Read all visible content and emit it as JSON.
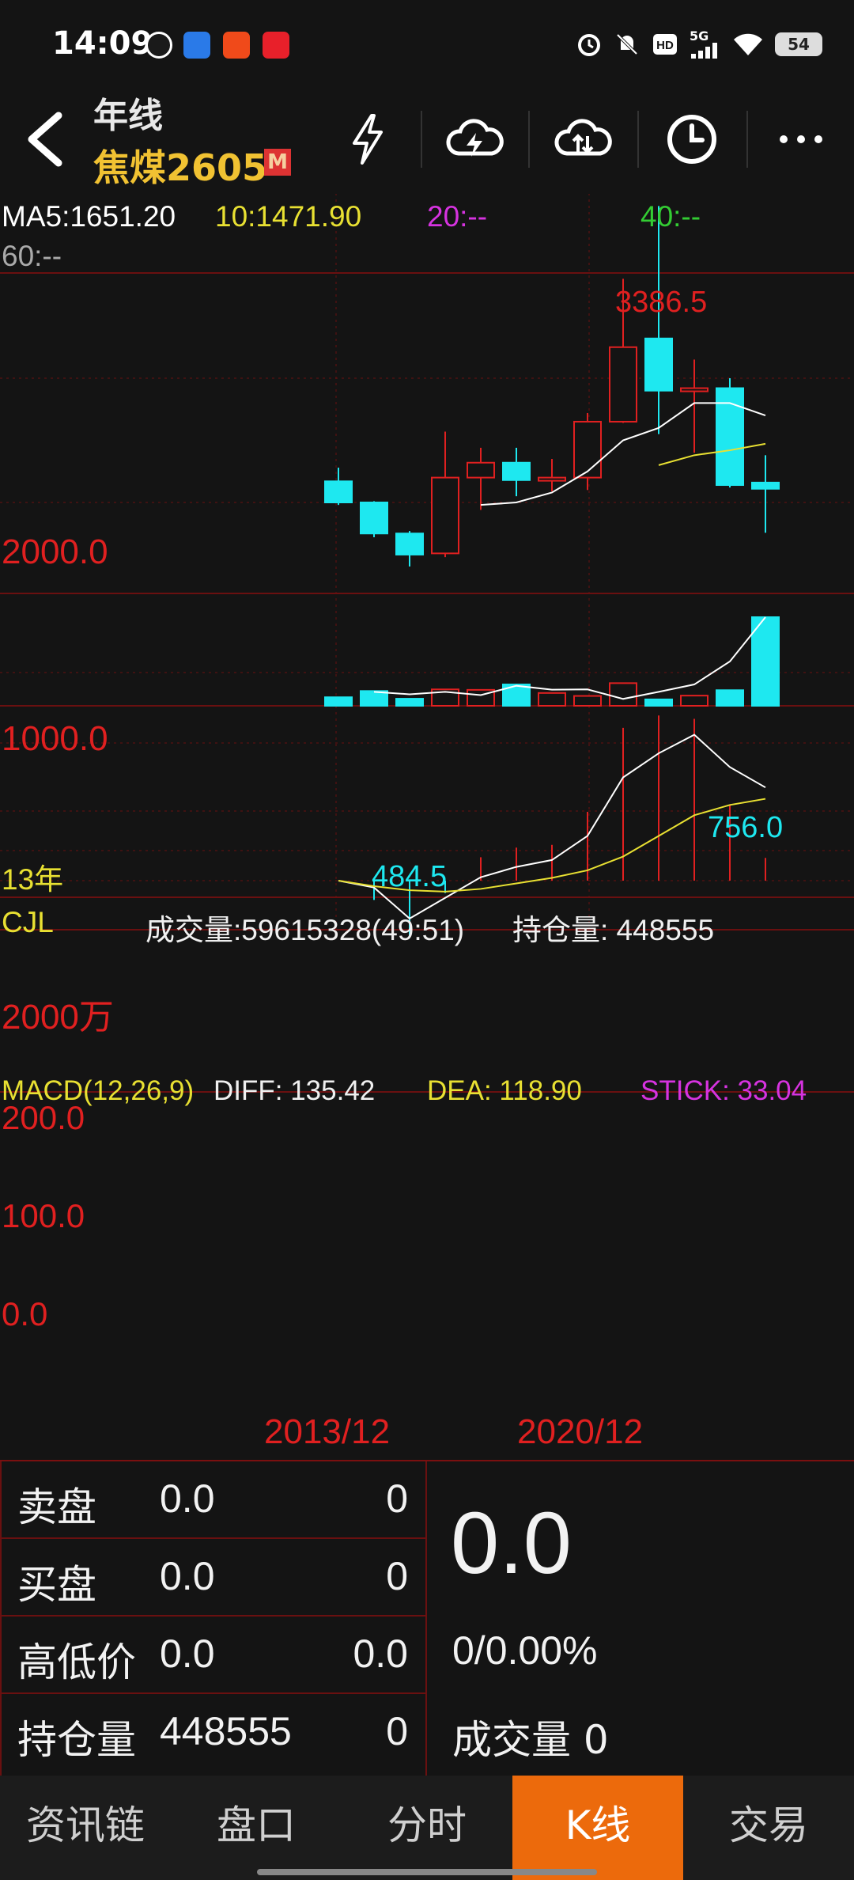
{
  "status_bar": {
    "time": "14:09",
    "battery": "54",
    "network": "5G",
    "icons": [
      "alarm-icon",
      "mute-icon",
      "hd-icon",
      "signal-icon",
      "wifi-icon",
      "battery-icon"
    ]
  },
  "header": {
    "period": "年线",
    "contract": "焦煤2605",
    "market_badge": "M",
    "actions": [
      "lightning-icon",
      "cloud-lightning-icon",
      "cloud-sync-icon",
      "clock-icon",
      "more-icon"
    ]
  },
  "ma_legend": {
    "ma5": "MA5:1651.20",
    "ma10": "10:1471.90",
    "ma20": "20:--",
    "ma40": "40:--",
    "ma60": "60:--"
  },
  "price_panel": {
    "y_labels": [
      "2000.0",
      "1000.0"
    ],
    "high_label": "3386.5",
    "low_label": "484.5",
    "last_low_label": "756.0",
    "period_tag": "13年"
  },
  "volume_panel": {
    "title": "CJL",
    "volume_text": "成交量:59615328(49:51)",
    "oi_text": "持仓量: 448555",
    "y_label": "2000万"
  },
  "macd_panel": {
    "title": "MACD(12,26,9)",
    "diff_text": "DIFF: 135.42",
    "dea_text": "DEA: 118.90",
    "stick_text": "STICK: 33.04",
    "y_labels": [
      "200.0",
      "100.0",
      "0.0"
    ]
  },
  "x_labels": [
    "2013/12",
    "2020/12"
  ],
  "chart_data": {
    "type": "candlestick",
    "candles": [
      {
        "o": 1170,
        "h": 1280,
        "l": 980,
        "c": 1000
      },
      {
        "o": 1000,
        "h": 1010,
        "l": 720,
        "c": 750
      },
      {
        "o": 750,
        "h": 770,
        "l": 484.5,
        "c": 580
      },
      {
        "o": 590,
        "h": 1570,
        "l": 560,
        "c": 1200
      },
      {
        "o": 1200,
        "h": 1440,
        "l": 940,
        "c": 1320
      },
      {
        "o": 1320,
        "h": 1440,
        "l": 1050,
        "c": 1180
      },
      {
        "o": 1180,
        "h": 1350,
        "l": 1090,
        "c": 1200
      },
      {
        "o": 1200,
        "h": 1720,
        "l": 1100,
        "c": 1650
      },
      {
        "o": 1650,
        "h": 2800,
        "l": 1640,
        "c": 2250
      },
      {
        "o": 2320,
        "h": 3386.5,
        "l": 1550,
        "c": 1900
      },
      {
        "o": 1900,
        "h": 2150,
        "l": 1400,
        "c": 1920
      },
      {
        "o": 1920,
        "h": 2000,
        "l": 1120,
        "c": 1140
      },
      {
        "o": 1160,
        "h": 1380,
        "l": 756,
        "c": 1110
      }
    ],
    "ma5": [
      null,
      null,
      null,
      null,
      980,
      1000,
      1080,
      1250,
      1500,
      1600,
      1800,
      1800,
      1700
    ],
    "ma10": [
      null,
      null,
      null,
      null,
      null,
      null,
      null,
      null,
      null,
      1300,
      1380,
      1420,
      1471.9
    ],
    "volume": [
      520,
      900,
      430,
      1000,
      970,
      1300,
      780,
      600,
      1380,
      390,
      620,
      950,
      5400
    ],
    "volume_line": [
      null,
      850,
      700,
      850,
      650,
      1220,
      980,
      1000,
      420,
      850,
      1300,
      2700,
      5400
    ],
    "diff": [
      0,
      -10,
      -55,
      -25,
      5,
      20,
      30,
      65,
      150,
      185,
      212,
      165,
      135.42
    ],
    "dea": [
      0,
      -8,
      -14,
      -16,
      -12,
      -4,
      4,
      15,
      35,
      65,
      95,
      110,
      118.9
    ],
    "stick": [
      0,
      -28,
      -82,
      -18,
      34,
      48,
      52,
      100,
      222,
      240,
      235,
      110,
      33.04
    ],
    "ylim_price": [
      300,
      3600
    ],
    "ylim_macd": [
      -80,
      220
    ]
  },
  "quote_panel": {
    "rows": [
      {
        "label": "卖盘",
        "v1": "0.0",
        "v2": "0"
      },
      {
        "label": "买盘",
        "v1": "0.0",
        "v2": "0"
      },
      {
        "label": "高低价",
        "v1": "0.0",
        "v2": "0.0"
      },
      {
        "label": "持仓量",
        "v1": "448555",
        "v2": "0"
      }
    ],
    "last_price": "0.0",
    "change": "0/0.00%",
    "volume_label": "成交量 0"
  },
  "tabs": [
    "资讯链",
    "盘口",
    "分时",
    "K线",
    "交易"
  ],
  "active_tab": "K线",
  "colors": {
    "up": "#e02020",
    "down": "#1ee8f0",
    "grid": "#6a1010",
    "ma5": "#ffffff",
    "ma10": "#e8e032",
    "accent": "#ec6a0c"
  }
}
